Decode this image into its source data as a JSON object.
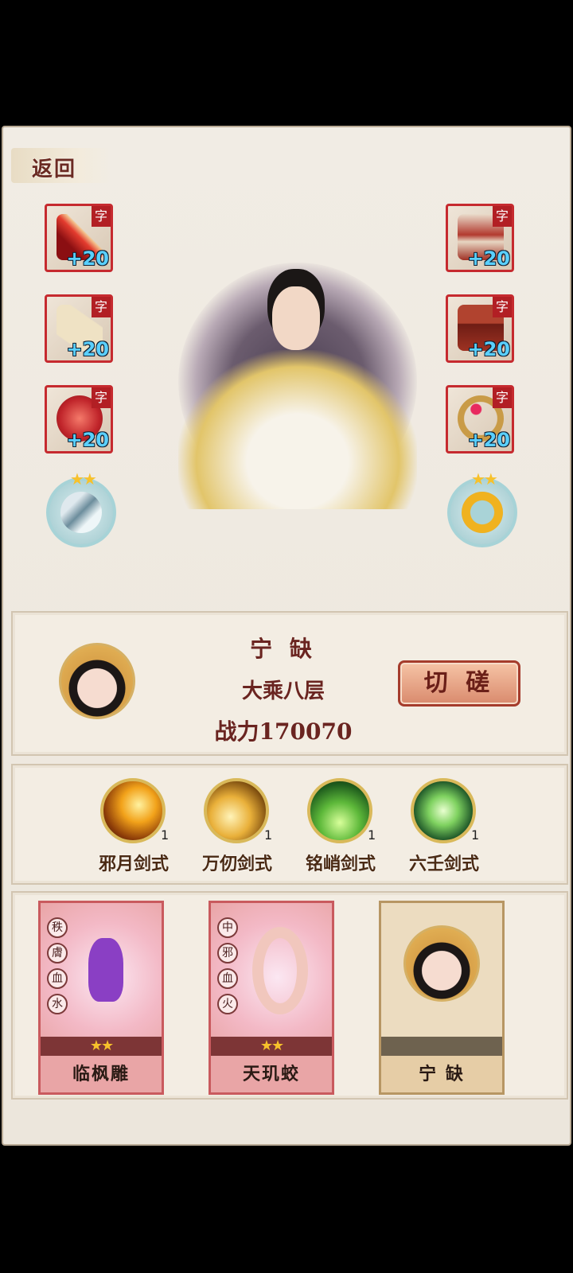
{
  "back_label": "返回",
  "equipment_left": [
    {
      "tag": "字",
      "level": "+20",
      "icon": "red-sword-icon"
    },
    {
      "tag": "字",
      "level": "+20",
      "icon": "scroll-icon"
    },
    {
      "tag": "字",
      "level": "+20",
      "icon": "red-orb-icon"
    }
  ],
  "equipment_right": [
    {
      "tag": "字",
      "level": "+20",
      "icon": "armor-icon"
    },
    {
      "tag": "字",
      "level": "+20",
      "icon": "dragon-box-icon"
    },
    {
      "tag": "字",
      "level": "+20",
      "icon": "ruby-ring-icon"
    }
  ],
  "round_left": {
    "stars": "★★",
    "icon": "claw-icon"
  },
  "round_right": {
    "stars": "★★",
    "icon": "gold-ring-icon"
  },
  "profile": {
    "name": "宁 缺",
    "realm": "大乘八层",
    "power": "战力170070",
    "challenge_label": "切 磋"
  },
  "skills": [
    {
      "name": "邪月剑式",
      "count": "1",
      "icon": "fire-slash-icon"
    },
    {
      "name": "万仞剑式",
      "count": "1",
      "icon": "golden-swirl-icon"
    },
    {
      "name": "铭峭剑式",
      "count": "1",
      "icon": "green-tree-icon"
    },
    {
      "name": "六壬剑式",
      "count": "1",
      "icon": "green-figure-icon"
    }
  ],
  "companions": [
    {
      "name": "临枫雕",
      "stars": "★★",
      "attrs": [
        "秩",
        "膚",
        "血",
        "水"
      ],
      "icon": "purple-bird-icon"
    },
    {
      "name": "天玑蛟",
      "stars": "★★",
      "attrs": [
        "中",
        "邪",
        "血",
        "火"
      ],
      "icon": "white-serpent-icon"
    },
    {
      "name": "宁 缺",
      "stars": "",
      "attrs": [],
      "icon": "portrait-icon"
    }
  ],
  "colors": {
    "accent_red": "#c62a2f",
    "text_dark_red": "#6a2420",
    "gold": "#d9b95a"
  }
}
